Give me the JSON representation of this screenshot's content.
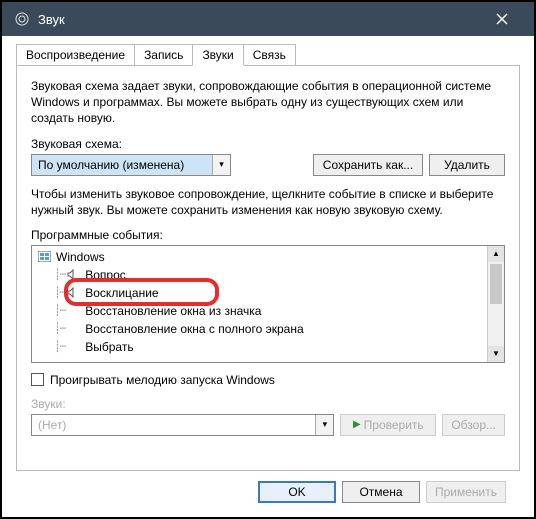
{
  "window": {
    "title": "Звук"
  },
  "tabs": {
    "items": [
      {
        "label": "Воспроизведение"
      },
      {
        "label": "Запись"
      },
      {
        "label": "Звуки"
      },
      {
        "label": "Связь"
      }
    ]
  },
  "panel": {
    "intro": "Звуковая схема задает звуки, сопровождающие события в операционной системе Windows и программах. Вы можете выбрать одну из существующих схем или создать новую.",
    "schemeLabel": "Звуковая схема:",
    "schemeValue": "По умолчанию (изменена)",
    "saveAsBtn": "Сохранить как...",
    "deleteBtn": "Удалить",
    "hint": "Чтобы изменить звуковое сопровождение, щелкните событие в списке и выберите нужный звук. Вы можете сохранить изменения как новую звуковую схему.",
    "eventsLabel": "Программные события:",
    "tree": {
      "root": "Windows",
      "items": [
        "Вопрос",
        "Восклицание",
        "Восстановление окна из значка",
        "Восстановление окна с полного экрана",
        "Выбрать"
      ]
    },
    "playStartupLabel": "Проигрывать мелодию запуска Windows",
    "soundsLabel": "Звуки:",
    "soundsValue": "(Нет)",
    "testBtn": "Проверить",
    "browseBtn": "Обзор..."
  },
  "footer": {
    "ok": "OK",
    "cancel": "Отмена",
    "apply": "Применить"
  }
}
